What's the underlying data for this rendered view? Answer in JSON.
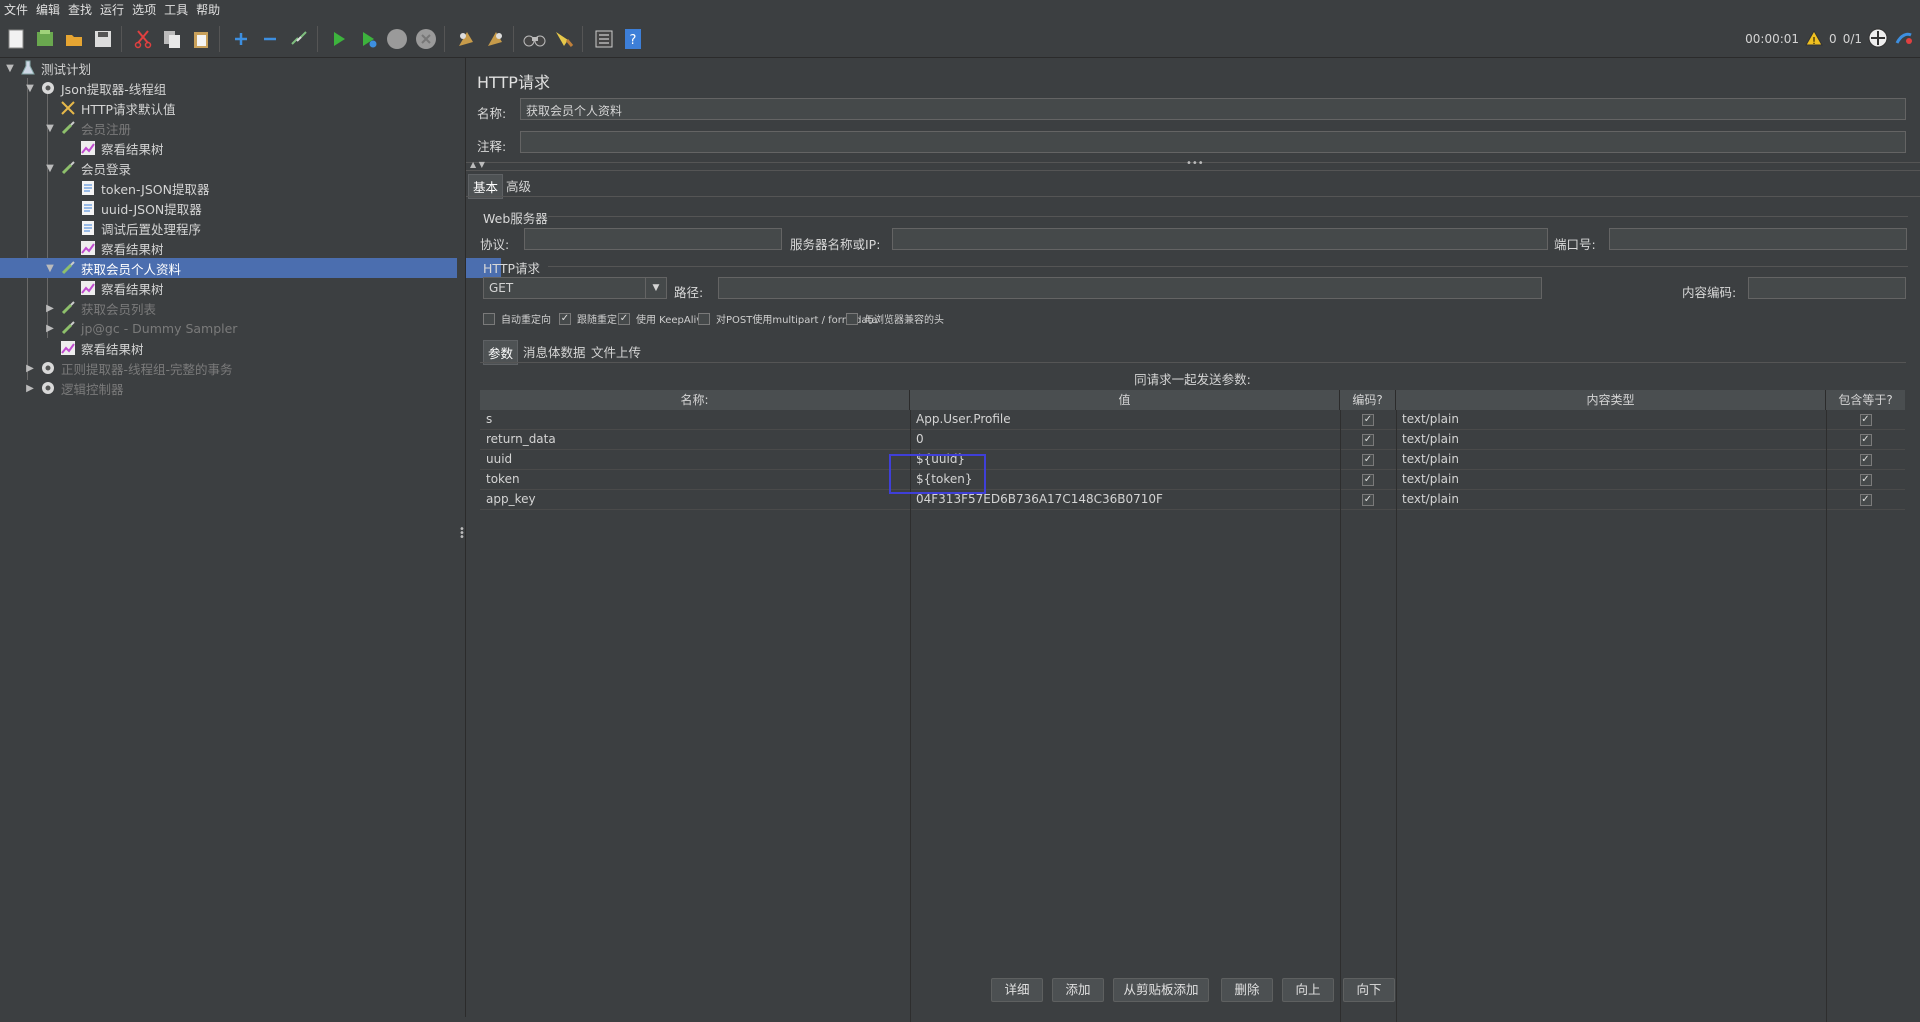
{
  "menu": [
    "文件",
    "编辑",
    "查找",
    "运行",
    "选项",
    "工具",
    "帮助"
  ],
  "toolbar": {
    "timer": "00:00:01",
    "warnings": "0",
    "threads": "0/1"
  },
  "tree": [
    {
      "label": "测试计划",
      "icon": "flask-icon",
      "disabled": false
    },
    {
      "label": "Json提取器-线程组",
      "icon": "gear-icon",
      "disabled": false
    },
    {
      "label": "HTTP请求默认值",
      "icon": "tools-icon",
      "disabled": false
    },
    {
      "label": "会员注册",
      "icon": "pipette-icon",
      "disabled": true
    },
    {
      "label": "察看结果树",
      "icon": "chart-icon",
      "disabled": false
    },
    {
      "label": "会员登录",
      "icon": "pipette-icon",
      "disabled": false
    },
    {
      "label": "token-JSON提取器",
      "icon": "document-icon",
      "disabled": false
    },
    {
      "label": "uuid-JSON提取器",
      "icon": "document-icon",
      "disabled": false
    },
    {
      "label": "调试后置处理程序",
      "icon": "document-icon",
      "disabled": false
    },
    {
      "label": "察看结果树",
      "icon": "chart-icon",
      "disabled": false
    },
    {
      "label": "获取会员个人资料",
      "icon": "pipette-icon",
      "disabled": false
    },
    {
      "label": "察看结果树",
      "icon": "chart-icon",
      "disabled": false
    },
    {
      "label": "获取会员列表",
      "icon": "pipette-icon",
      "disabled": true
    },
    {
      "label": "jp@gc - Dummy Sampler",
      "icon": "pipette-icon",
      "disabled": true
    },
    {
      "label": "察看结果树",
      "icon": "chart-icon",
      "disabled": false
    },
    {
      "label": "正则提取器-线程组-完整的事务",
      "icon": "gear-icon",
      "disabled": true
    },
    {
      "label": "逻辑控制器",
      "icon": "gear-icon",
      "disabled": true
    }
  ],
  "panel": {
    "title": "HTTP请求",
    "name_label": "名称:",
    "name_value": "获取会员个人资料",
    "comment_label": "注释:",
    "comment_value": "",
    "tabs": [
      "基本",
      "高级"
    ],
    "web_server_title": "Web服务器",
    "protocol_label": "协议:",
    "protocol_value": "",
    "server_label": "服务器名称或IP:",
    "server_value": "",
    "port_label": "端口号:",
    "port_value": "",
    "http_request_title": "HTTP请求",
    "method": "GET",
    "path_label": "路径:",
    "path_value": "",
    "encoding_label": "内容编码:",
    "encoding_value": "",
    "checkboxes": [
      {
        "label": "自动重定向",
        "checked": false
      },
      {
        "label": "跟随重定向",
        "checked": true
      },
      {
        "label": "使用 KeepAlive",
        "checked": true
      },
      {
        "label": "对POST使用multipart / form-data",
        "checked": false
      },
      {
        "label": "与浏览器兼容的头",
        "checked": false
      }
    ],
    "subtabs": [
      "参数",
      "消息体数据",
      "文件上传"
    ],
    "table_caption": "同请求一起发送参数:",
    "columns": [
      "名称:",
      "值",
      "编码?",
      "内容类型",
      "包含等于?"
    ],
    "rows": [
      {
        "name": "s",
        "value": "App.User.Profile",
        "encode": true,
        "content_type": "text/plain",
        "include_equals": true
      },
      {
        "name": "return_data",
        "value": "0",
        "encode": true,
        "content_type": "text/plain",
        "include_equals": true
      },
      {
        "name": "uuid",
        "value": "${uuid}",
        "encode": true,
        "content_type": "text/plain",
        "include_equals": true
      },
      {
        "name": "token",
        "value": "${token}",
        "encode": true,
        "content_type": "text/plain",
        "include_equals": true
      },
      {
        "name": "app_key",
        "value": "04F313F57ED6B736A17C148C36B0710F",
        "encode": true,
        "content_type": "text/plain",
        "include_equals": true
      }
    ],
    "buttons": [
      "详细",
      "添加",
      "从剪贴板添加",
      "删除",
      "向上",
      "向下"
    ]
  }
}
